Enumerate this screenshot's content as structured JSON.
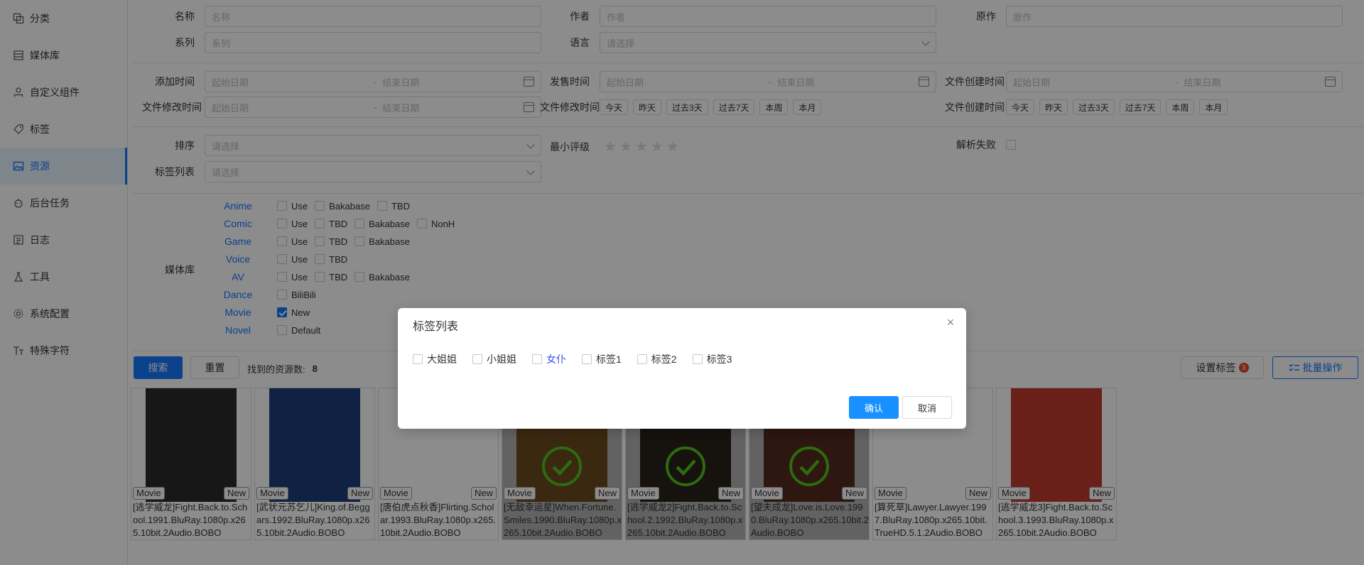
{
  "sidebar": {
    "items": [
      {
        "label": "分类",
        "icon": "copy-icon"
      },
      {
        "label": "媒体库",
        "icon": "library-icon"
      },
      {
        "label": "自定义组件",
        "icon": "user-icon"
      },
      {
        "label": "标签",
        "icon": "tag-icon"
      },
      {
        "label": "资源",
        "icon": "picture-icon",
        "active": true
      },
      {
        "label": "后台任务",
        "icon": "task-icon"
      },
      {
        "label": "日志",
        "icon": "log-icon"
      },
      {
        "label": "工具",
        "icon": "flask-icon"
      },
      {
        "label": "系统配置",
        "icon": "gear-icon"
      },
      {
        "label": "特殊字符",
        "icon": "text-icon"
      }
    ]
  },
  "filters": {
    "name_label": "名称",
    "name_placeholder": "名称",
    "author_label": "作者",
    "author_placeholder": "作者",
    "original_label": "原作",
    "original_placeholder": "原作",
    "series_label": "系列",
    "series_placeholder": "系列",
    "language_label": "语言",
    "language_placeholder": "请选择",
    "added_label": "添加时间",
    "start_placeholder": "起始日期",
    "end_placeholder": "结束日期",
    "range_sep": "-",
    "published_label": "发售时间",
    "file_created_label": "文件创建时间",
    "file_modified_label": "文件修改时间",
    "quick_modified_label": "文件修改时间",
    "quick_created_label": "文件创建时间",
    "quick_buttons": [
      "今天",
      "昨天",
      "过去3天",
      "过去7天",
      "本周",
      "本月"
    ],
    "order_label": "排序",
    "order_placeholder": "请选择",
    "min_rating_label": "最小评级",
    "stars": [
      "★",
      "★",
      "★",
      "★",
      "★"
    ],
    "parse_failed_label": "解析失败",
    "tag_list_label": "标签列表",
    "tag_list_placeholder": "请选择",
    "media_library_label": "媒体库"
  },
  "media_libraries": [
    {
      "name": "Anime",
      "options": [
        {
          "label": "Use",
          "checked": false
        },
        {
          "label": "Bakabase",
          "checked": false
        },
        {
          "label": "TBD",
          "checked": false
        }
      ]
    },
    {
      "name": "Comic",
      "options": [
        {
          "label": "Use",
          "checked": false
        },
        {
          "label": "TBD",
          "checked": false
        },
        {
          "label": "Bakabase",
          "checked": false
        },
        {
          "label": "NonH",
          "checked": false
        }
      ]
    },
    {
      "name": "Game",
      "options": [
        {
          "label": "Use",
          "checked": false
        },
        {
          "label": "TBD",
          "checked": false
        },
        {
          "label": "Bakabase",
          "checked": false
        }
      ]
    },
    {
      "name": "Voice",
      "options": [
        {
          "label": "Use",
          "checked": false
        },
        {
          "label": "TBD",
          "checked": false
        }
      ]
    },
    {
      "name": "AV",
      "options": [
        {
          "label": "Use",
          "checked": false
        },
        {
          "label": "TBD",
          "checked": false
        },
        {
          "label": "Bakabase",
          "checked": false
        }
      ]
    },
    {
      "name": "Dance",
      "options": [
        {
          "label": "BiliBili",
          "checked": false
        }
      ]
    },
    {
      "name": "Movie",
      "options": [
        {
          "label": "New",
          "checked": true
        }
      ]
    },
    {
      "name": "Novel",
      "options": [
        {
          "label": "Default",
          "checked": false
        }
      ]
    }
  ],
  "actions": {
    "search_label": "搜索",
    "reset_label": "重置",
    "found_label": "找到的资源数:",
    "found_count": "8",
    "set_tags_label": "设置标签",
    "set_tags_badge": "3",
    "batch_label": "批量操作"
  },
  "resources": [
    {
      "category": "Movie",
      "library": "New",
      "name": "[逃学威龙]Fight.Back.to.School.1991.BluRay.1080p.x265.10bit.2Audio.BOBO",
      "selected": false,
      "poster_color": "#2a2a2a"
    },
    {
      "category": "Movie",
      "library": "New",
      "name": "[武状元苏乞儿]King.of.Beggars.1992.BluRay.1080p.x265.10bit.2Audio.BOBO",
      "selected": false,
      "poster_color": "#1d3f7a"
    },
    {
      "category": "Movie",
      "library": "New",
      "name": "[唐伯虎点秋香]Flirting.Scholar.1993.BluRay.1080p.x265.10bit.2Audio.BOBO",
      "selected": false,
      "poster_color": "#ffffff"
    },
    {
      "category": "Movie",
      "library": "New",
      "name": "[无敌幸运星]When.Fortune.Smiles.1990.BluRay.1080p.x265.10bit.2Audio.BOBO",
      "selected": true,
      "poster_color": "#9b6b2e"
    },
    {
      "category": "Movie",
      "library": "New",
      "name": "[逃学威龙2]Fight.Back.to.School.2.1992.BluRay.1080p.x265.10bit.2Audio.BOBO",
      "selected": true,
      "poster_color": "#3b3226"
    },
    {
      "category": "Movie",
      "library": "New",
      "name": "[望夫成龙]Love.is.Love.1990.BluRay.1080p.x265.10bit.2Audio.BOBO",
      "selected": true,
      "poster_color": "#7a3b2e"
    },
    {
      "category": "Movie",
      "library": "New",
      "name": "[算死草]Lawyer.Lawyer.1997.BluRay.1080p.x265.10bit.TrueHD.5.1.2Audio.BOBO",
      "selected": false,
      "poster_color": "#ffffff"
    },
    {
      "category": "Movie",
      "library": "New",
      "name": "[逃学威龙3]Fight.Back.to.School.3.1993.BluRay.1080p.x265.10bit.2Audio.BOBO",
      "selected": false,
      "poster_color": "#c23b2e"
    }
  ],
  "modal": {
    "title": "标签列表",
    "close": "×",
    "tags": [
      {
        "label": "大姐姐",
        "checked": false
      },
      {
        "label": "小姐姐",
        "checked": false
      },
      {
        "label": "女仆",
        "checked": false,
        "highlight": true
      },
      {
        "label": "标签1",
        "checked": false
      },
      {
        "label": "标签2",
        "checked": false
      },
      {
        "label": "标签3",
        "checked": false
      }
    ],
    "ok_label": "确认",
    "cancel_label": "取消"
  },
  "colors": {
    "accent": "#1677ff",
    "check_green": "#52c41a",
    "badge_red": "#e8452c"
  }
}
